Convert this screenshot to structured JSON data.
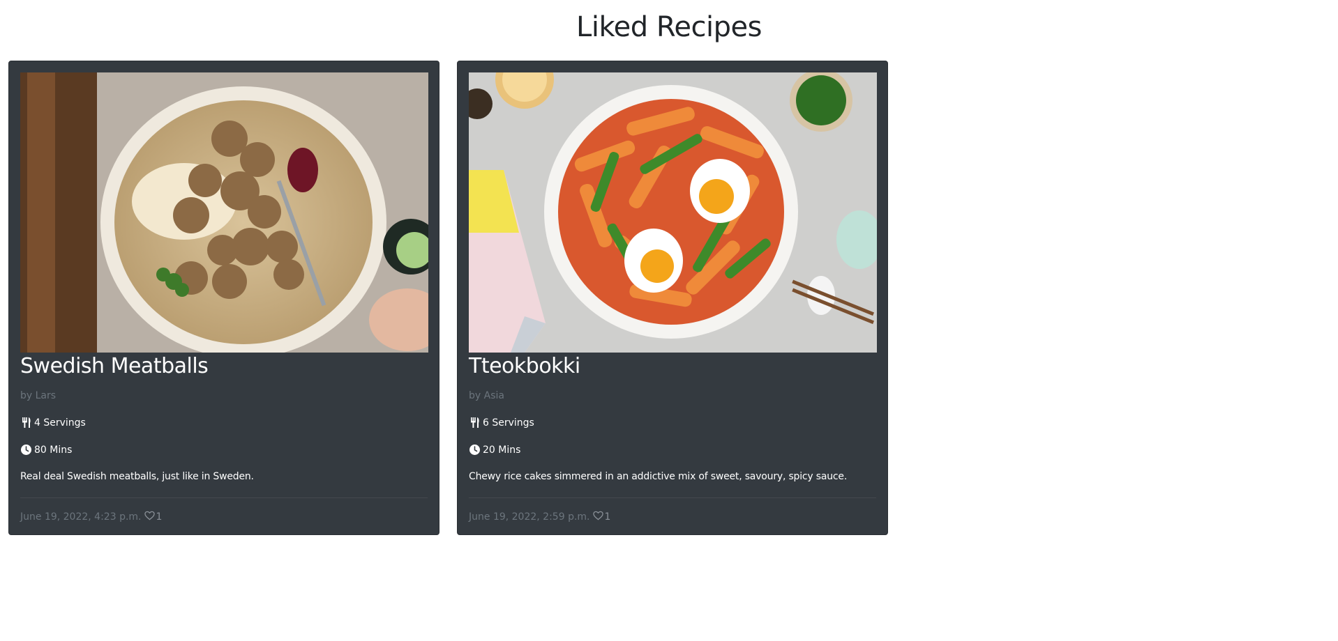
{
  "page": {
    "title": "Liked Recipes"
  },
  "cards": [
    {
      "title": "Swedish Meatballs",
      "author": "by Lars",
      "servings": "4 Servings",
      "time": "80 Mins",
      "description": "Real deal Swedish meatballs, just like in Sweden.",
      "date": "June 19, 2022, 4:23 p.m.",
      "likes": "1",
      "image_icon": "swedish-meatballs-photo"
    },
    {
      "title": "Tteokbokki",
      "author": "by Asia",
      "servings": "6 Servings",
      "time": "20 Mins",
      "description": "Chewy rice cakes simmered in an addictive mix of sweet, savoury, spicy sauce.",
      "date": "June 19, 2022, 2:59 p.m.",
      "likes": "1",
      "image_icon": "tteokbokki-photo"
    }
  ],
  "colors": {
    "card_bg": "#343a40",
    "muted_text": "#6c757d",
    "heading": "#212529"
  },
  "icons": {
    "servings": "utensils-icon",
    "time": "clock-icon",
    "like": "heart-icon"
  }
}
